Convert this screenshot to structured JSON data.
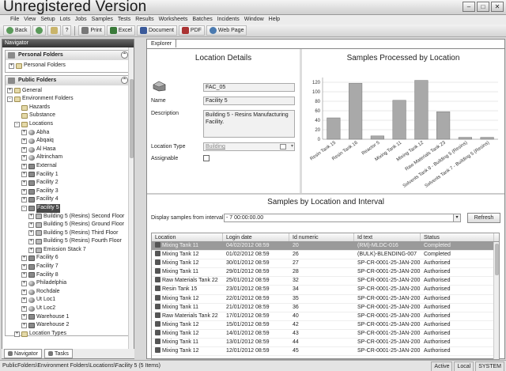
{
  "window": {
    "watermark": "Unregistered Version"
  },
  "menu": [
    "File",
    "View",
    "Setup",
    "Lots",
    "Jobs",
    "Samples",
    "Tests",
    "Results",
    "Worksheets",
    "Batches",
    "Incidents",
    "Window",
    "Help"
  ],
  "toolbar": {
    "back": "Back",
    "print": "Print",
    "excel": "Excel",
    "document": "Document",
    "pdf": "PDF",
    "webpage": "Web Page"
  },
  "navigator": {
    "title": "Navigator",
    "personal": {
      "title": "Personal Folders",
      "items": [
        "Personal Folders"
      ]
    },
    "public": {
      "title": "Public Folders",
      "nodes": [
        {
          "label": "General",
          "level": 0,
          "exp": "+",
          "icon": "folder"
        },
        {
          "label": "Environment Folders",
          "level": 0,
          "exp": "-",
          "icon": "folder"
        },
        {
          "label": "Hazards",
          "level": 1,
          "exp": "",
          "icon": "folder"
        },
        {
          "label": "Substance",
          "level": 1,
          "exp": "",
          "icon": "folder"
        },
        {
          "label": "Locations",
          "level": 1,
          "exp": "-",
          "icon": "folder"
        },
        {
          "label": "Abha",
          "level": 2,
          "exp": "+",
          "icon": "globe"
        },
        {
          "label": "Abqaiq",
          "level": 2,
          "exp": "+",
          "icon": "globe"
        },
        {
          "label": "Al Hasa",
          "level": 2,
          "exp": "+",
          "icon": "globe"
        },
        {
          "label": "Altrincham",
          "level": 2,
          "exp": "+",
          "icon": "globe"
        },
        {
          "label": "External",
          "level": 2,
          "exp": "+",
          "icon": "fac"
        },
        {
          "label": "Facility 1",
          "level": 2,
          "exp": "+",
          "icon": "fac"
        },
        {
          "label": "Facility 2",
          "level": 2,
          "exp": "+",
          "icon": "fac"
        },
        {
          "label": "Facility 3",
          "level": 2,
          "exp": "+",
          "icon": "fac"
        },
        {
          "label": "Facility 4",
          "level": 2,
          "exp": "+",
          "icon": "fac"
        },
        {
          "label": "Facility 5",
          "level": 2,
          "exp": "-",
          "icon": "fac",
          "selected": true
        },
        {
          "label": "Building 5 (Resins) Second Floor",
          "level": 3,
          "exp": "+",
          "icon": "sub"
        },
        {
          "label": "Building 5 (Resins) Ground Floor",
          "level": 3,
          "exp": "+",
          "icon": "sub"
        },
        {
          "label": "Building 5 (Resins) Third Floor",
          "level": 3,
          "exp": "+",
          "icon": "sub"
        },
        {
          "label": "Building 5 (Resins) Fourth Floor",
          "level": 3,
          "exp": "+",
          "icon": "sub"
        },
        {
          "label": "Emission Stack 7",
          "level": 3,
          "exp": "+",
          "icon": "sub"
        },
        {
          "label": "Facility 6",
          "level": 2,
          "exp": "+",
          "icon": "fac"
        },
        {
          "label": "Facility 7",
          "level": 2,
          "exp": "+",
          "icon": "fac"
        },
        {
          "label": "Facility 8",
          "level": 2,
          "exp": "+",
          "icon": "fac"
        },
        {
          "label": "Philadelphia",
          "level": 2,
          "exp": "+",
          "icon": "globe"
        },
        {
          "label": "Rochdale",
          "level": 2,
          "exp": "+",
          "icon": "globe"
        },
        {
          "label": "Ut Loc1",
          "level": 2,
          "exp": "+",
          "icon": "globe"
        },
        {
          "label": "Ut Loc2",
          "level": 2,
          "exp": "+",
          "icon": "globe"
        },
        {
          "label": "Warehouse 1",
          "level": 2,
          "exp": "+",
          "icon": "fac"
        },
        {
          "label": "Warehouse 2",
          "level": 2,
          "exp": "+",
          "icon": "fac"
        },
        {
          "label": "Location Types",
          "level": 1,
          "exp": "+",
          "icon": "folder"
        }
      ]
    },
    "tabs": [
      "Navigator",
      "Tasks"
    ]
  },
  "explorer": {
    "tab": "Explorer",
    "details": {
      "title": "Location Details",
      "code": "FAC_05",
      "name_label": "Name",
      "name": "Facility 5",
      "description_label": "Description",
      "description": "Building 5 - Resins Manufacturing Facility.",
      "location_type_label": "Location Type",
      "location_type": "Building",
      "assignable_label": "Assignable"
    },
    "samples_section": {
      "title": "Samples by Location and Interval",
      "interval_label": "Display samples from interval",
      "interval_value": "- 7 00:00:00.00",
      "refresh": "Refresh",
      "columns": [
        "Location",
        "Login date",
        "Id numeric",
        "Id text",
        "Status"
      ],
      "rows": [
        [
          "Mixing Tank 11",
          "04/02/2012 08:59",
          "20",
          "(RM)-MLDC-016",
          "Completed"
        ],
        [
          "Mixing Tank 12",
          "01/02/2012 08:59",
          "26",
          "(BULK)-BLENDING-007",
          "Completed"
        ],
        [
          "Mixing Tank 12",
          "30/01/2012 08:59",
          "27",
          "SP-CR-0001-25-JAN-200...",
          "Authorised"
        ],
        [
          "Mixing Tank 11",
          "29/01/2012 08:59",
          "28",
          "SP-CR-0001-25-JAN-200...",
          "Authorised"
        ],
        [
          "Raw Materials Tank 22",
          "25/01/2012 08:59",
          "32",
          "SP-CR-0001-25-JAN-200...",
          "Authorised"
        ],
        [
          "Resin Tank 15",
          "23/01/2012 08:59",
          "34",
          "SP-CR-0001-25-JAN-200...",
          "Authorised"
        ],
        [
          "Mixing Tank 12",
          "22/01/2012 08:59",
          "35",
          "SP-CR-0001-25-JAN-200...",
          "Authorised"
        ],
        [
          "Mixing Tank 11",
          "21/01/2012 08:59",
          "36",
          "SP-CR-0001-25-JAN-200...",
          "Authorised"
        ],
        [
          "Raw Materials Tank 22",
          "17/01/2012 08:59",
          "40",
          "SP-CR-0001-25-JAN-200...",
          "Authorised"
        ],
        [
          "Mixing Tank 12",
          "15/01/2012 08:59",
          "42",
          "SP-CR-0001-25-JAN-200...",
          "Authorised"
        ],
        [
          "Mixing Tank 12",
          "14/01/2012 08:59",
          "43",
          "SP-CR-0001-25-JAN-200...",
          "Authorised"
        ],
        [
          "Mixing Tank 11",
          "13/01/2012 08:59",
          "44",
          "SP-CR-0001-25-JAN-200...",
          "Authorised"
        ],
        [
          "Mixing Tank 12",
          "12/01/2012 08:59",
          "45",
          "SP-CR-0001-25-JAN-200...",
          "Authorised"
        ]
      ]
    }
  },
  "chart_data": {
    "type": "bar",
    "title": "Samples Processed by Location",
    "categories": [
      "Resin Tank 15",
      "Resin Tank 16",
      "Reactor 5",
      "Mixing Tank 11",
      "Mixing Tank 12",
      "Raw Materials Tank 23",
      "Solvents Tank 8 - Building 5 (Resins)",
      "Solvents Tank 7 - Building 5 (Resins)"
    ],
    "values": [
      45,
      118,
      7,
      82,
      124,
      58,
      4,
      4
    ],
    "ylim": [
      0,
      130
    ],
    "yticks": [
      0,
      20,
      40,
      60,
      80,
      100,
      120
    ],
    "grid": true,
    "bar_color": "#a9a9a9"
  },
  "status": {
    "path": "PublicFolders\\Environment Folders\\Locations\\Facility 5 (5 Items)",
    "right": [
      "Active",
      "Local",
      "SYSTEM"
    ]
  }
}
